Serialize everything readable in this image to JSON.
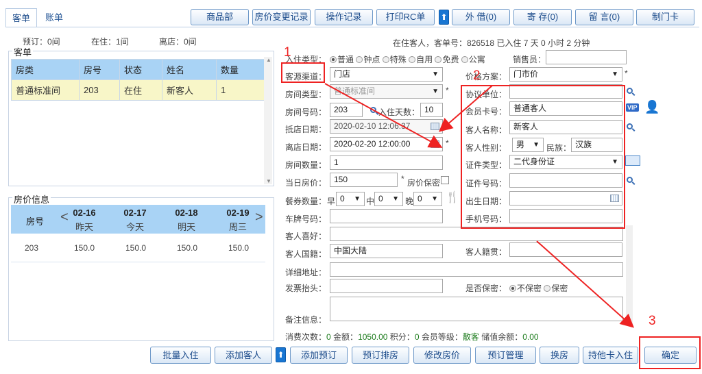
{
  "tabs": [
    "客单",
    "账单"
  ],
  "toolbar": [
    "商品部",
    "房价变更记录",
    "操作记录",
    "打印RC单",
    "外 借(0)",
    "寄 存(0)",
    "留 言(0)",
    "制门卡"
  ],
  "summary": {
    "reserved": "预订：0间",
    "in": "在住：1间",
    "left": "离店：0间"
  },
  "notice": "在住客人，客单号：826518 已入住 7 天 0 小时 2 分钟",
  "guest_list": {
    "legend": "客单",
    "headers": [
      "房类",
      "房号",
      "状态",
      "姓名",
      "数量"
    ],
    "rows": [
      [
        "普通标准间",
        "203",
        "在住",
        "新客人",
        "1"
      ]
    ]
  },
  "price_info": {
    "legend": "房价信息",
    "room_label": "房号",
    "dates": [
      {
        "d": "02-16",
        "w": "昨天"
      },
      {
        "d": "02-17",
        "w": "今天"
      },
      {
        "d": "02-18",
        "w": "明天"
      },
      {
        "d": "02-19",
        "w": "周三"
      }
    ],
    "row": [
      "203",
      "150.0",
      "150.0",
      "150.0",
      "150.0"
    ]
  },
  "form": {
    "checkin_type_label": "入住类型：",
    "checkin_types": [
      "普通",
      "钟点",
      "特殊",
      "自用",
      "免费",
      "公寓"
    ],
    "sales_label": "销售员：",
    "channel_label": "客源渠道：",
    "channel": "门店",
    "price_plan_label": "价格方案：",
    "price_plan": "门市价",
    "room_type_label": "房间类型：",
    "room_type": "普通标准间",
    "agreement_label": "协议单位：",
    "room_no_label": "房间号码：",
    "room_no": "203",
    "days_label": "入住天数：",
    "days": "10",
    "member_label": "会员卡号：",
    "member": "普通客人",
    "arrive_label": "抵店日期：",
    "arrive": "2020-02-10 12:06:37",
    "name_label": "客人名称：",
    "name": "新客人",
    "depart_label": "离店日期：",
    "depart": "2020-02-20 12:00:00",
    "gender_label": "客人性别：",
    "gender": "男",
    "nation_label": "民族：",
    "nation": "汉族",
    "rooms_label": "房间数量：",
    "rooms": "1",
    "idtype_label": "证件类型：",
    "idtype": "二代身份证",
    "price_label": "当日房价：",
    "price": "150",
    "price_secret": "房价保密",
    "idno_label": "证件号码：",
    "meal_label": "餐券数量：",
    "breakfast": "早",
    "lunch": "中",
    "dinner": "晚",
    "meal_val": "0",
    "birth_label": "出生日期：",
    "plate_label": "车牌号码：",
    "phone_label": "手机号码：",
    "hobby_label": "客人喜好：",
    "nationality_label": "客人国籍：",
    "nationality": "中国大陆",
    "origin_label": "客人籍贯：",
    "address_label": "详细地址：",
    "invoice_label": "发票抬头：",
    "secret_label": "是否保密：",
    "secret_no": "不保密",
    "secret_yes": "保密",
    "remark_label": "备注信息：",
    "vip": "VIP"
  },
  "stats": {
    "count_label": "消费次数：",
    "count": "0",
    "amount_label": "金额：",
    "amount": "1050.00",
    "points_label": "积分：",
    "points": "0",
    "level_label": "会员等级：",
    "level": "散客",
    "balance_label": "储值余额：",
    "balance": "0.00"
  },
  "bottom": [
    "批量入住",
    "添加客人",
    "添加预订",
    "预订排房",
    "修改房价",
    "预订管理",
    "换房",
    "持他卡入住",
    "确定"
  ],
  "annotations": [
    "1",
    "2",
    "3"
  ]
}
